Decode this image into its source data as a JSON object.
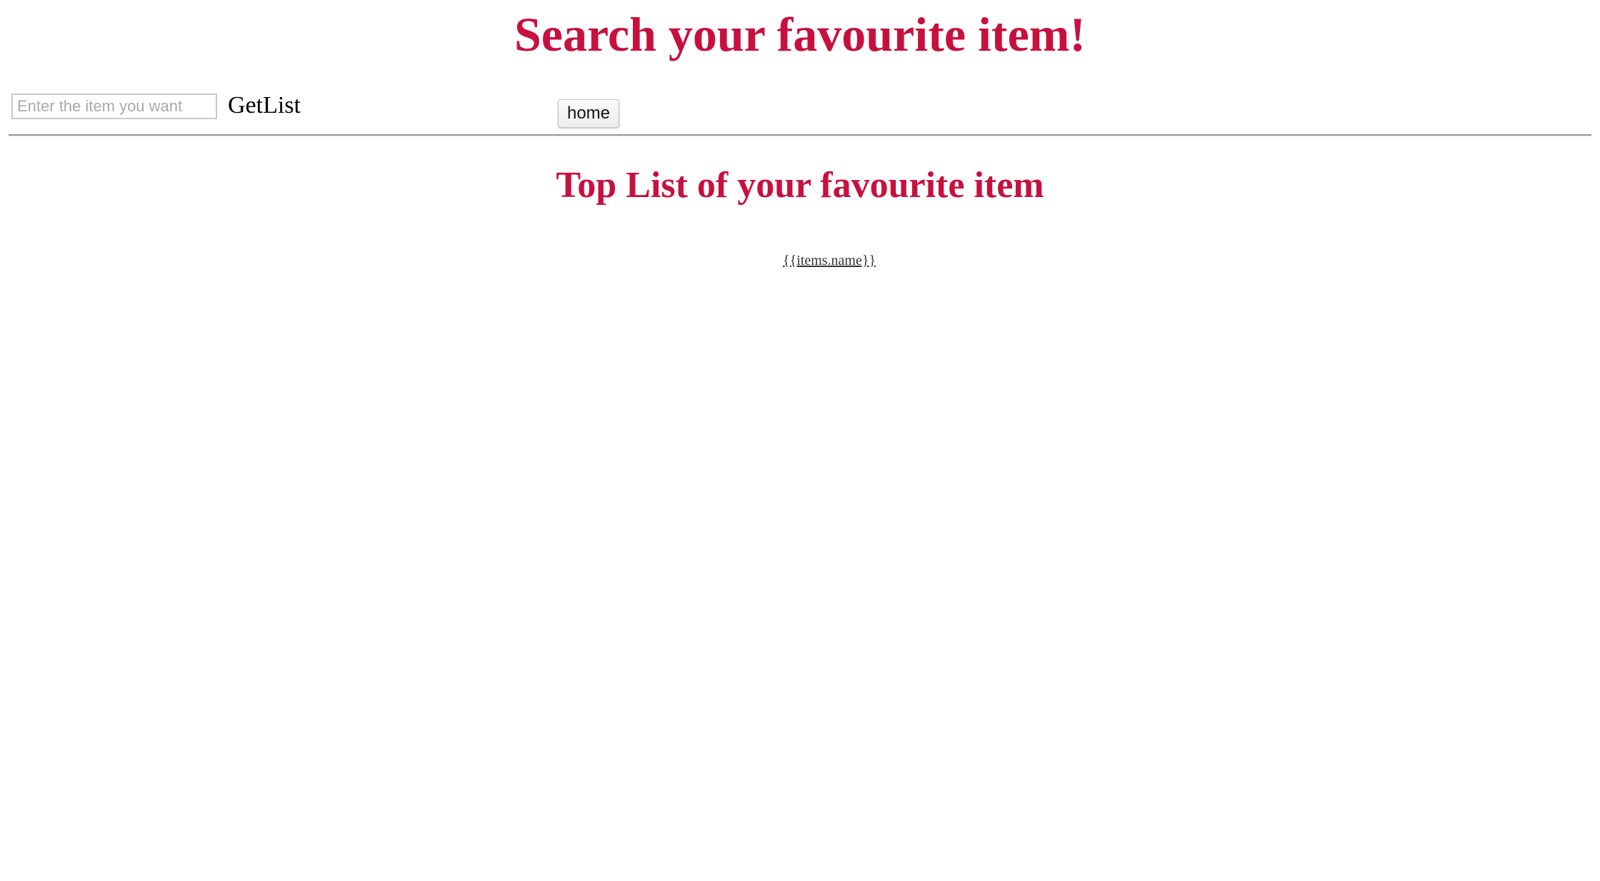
{
  "header": {
    "title": "Search your favourite item!"
  },
  "search": {
    "placeholder": "Enter the item you want",
    "value": "",
    "getlist_label": "GetList",
    "home_label": "home"
  },
  "list": {
    "title": "Top List of your favourite item",
    "items": [
      {
        "name": "{{items.name}}"
      }
    ]
  }
}
